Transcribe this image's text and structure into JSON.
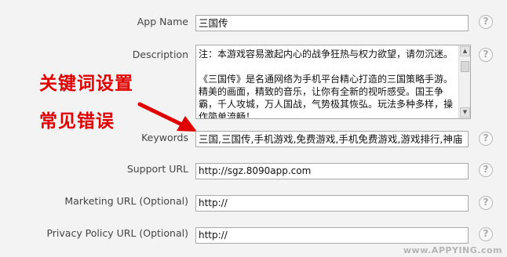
{
  "form": {
    "app_name": {
      "label": "App Name",
      "value": "三国传"
    },
    "description": {
      "label": "Description",
      "value": "注：本游戏容易激起内心的战争狂热与权力欲望，请勿沉迷。\n\n《三国传》是名通网络为手机平台精心打造的三国策略手游。精美的画面，精致的音乐，让你有全新的视听感受。国王争霸，千人攻城，万人国战，气势极其恢弘。玩法多种多样，操作简单流畅！"
    },
    "keywords": {
      "label": "Keywords",
      "value": "三国,三国传,手机游戏,免费游戏,手机免费游戏,游戏排行,神庙"
    },
    "support_url": {
      "label": "Support URL",
      "value": "http://sgz.8090app.com"
    },
    "marketing_url": {
      "label": "Marketing URL (Optional)",
      "value": "http://"
    },
    "privacy_url": {
      "label": "Privacy Policy URL (Optional)",
      "value": "http://"
    },
    "help_symbol": "?"
  },
  "annotation": {
    "line1": "关键词设置",
    "line2": "常见错误",
    "color": "#e00000"
  },
  "watermark": "www.APPYING.com",
  "scrollbar": {
    "up": "▲",
    "down": "▼"
  }
}
